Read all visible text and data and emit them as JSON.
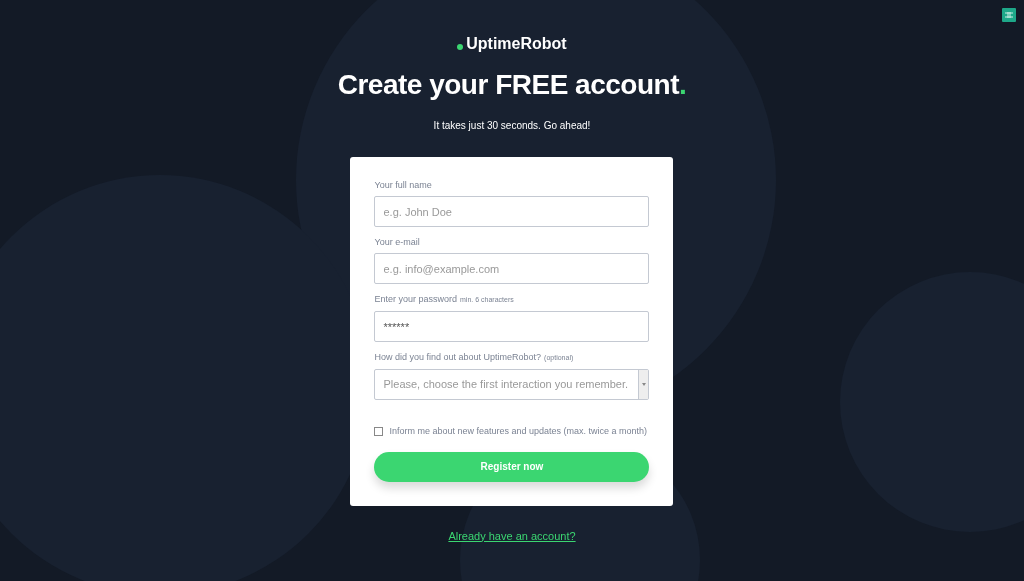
{
  "logo": {
    "text": "UptimeRobot"
  },
  "heading": {
    "text": "Create your FREE account",
    "accent": "."
  },
  "subtitle": "It takes just 30 seconds. Go ahead!",
  "form": {
    "fields": [
      {
        "kind": "text",
        "label": "Your full name",
        "placeholder": "e.g. John Doe"
      },
      {
        "kind": "text",
        "label": "Your e-mail",
        "placeholder": "e.g. info@example.com"
      },
      {
        "kind": "password",
        "label": "Enter your password",
        "hint": "min. 6 characters",
        "value": "******"
      },
      {
        "kind": "select",
        "label": "How did you find out about UptimeRobot?",
        "hint": "(optional)",
        "placeholder": "Please, choose the first interaction you remember."
      }
    ],
    "checkbox": {
      "label": "Inform me about new features and updates (max. twice a month)",
      "checked": false
    },
    "submit": "Register now"
  },
  "login_link": "Already have an account?"
}
